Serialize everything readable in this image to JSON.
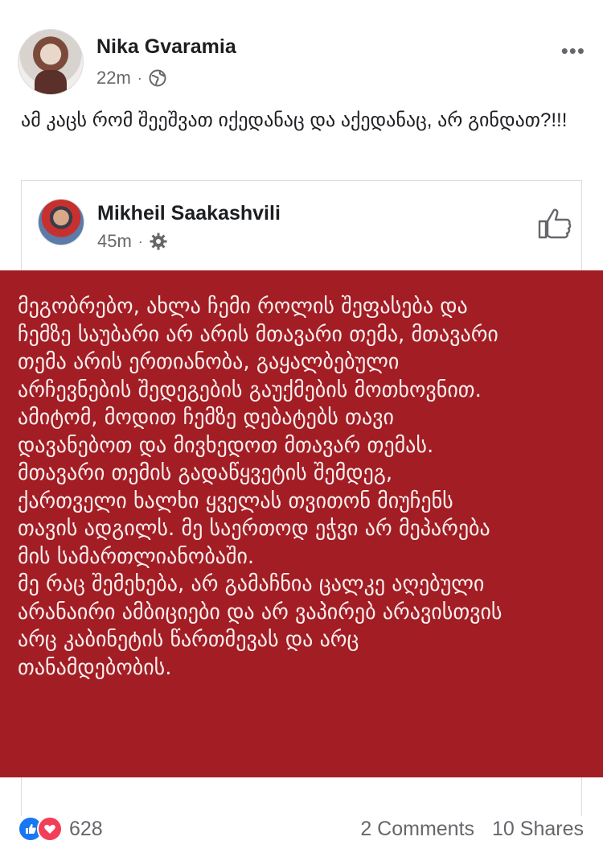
{
  "post": {
    "author": "Nika Gvaramia",
    "time": "22m",
    "separator": "·",
    "privacy_icon": "globe-icon",
    "more_label": "•••",
    "text": "ამ კაცს რომ შეეშვათ იქედანაც და აქედანაც, არ გინდათ?!!!"
  },
  "shared": {
    "author": "Mikheil Saakashvili",
    "time": "45m",
    "separator": "·",
    "privacy_icon": "gear-icon",
    "like_icon": "thumbs-up-icon",
    "text": "მეგობრებო, ახლა ჩემი როლის შეფასება და\nჩემზე საუბარი არ არის მთავარი თემა, მთავარი\nთემა არის ერთიანობა, გაყალბებული\nარჩევნების შედეგების გაუქმების მოთხოვნით.\nამიტომ, მოდით ჩემზე დებატებს თავი\nდავანებოთ და მივხედოთ მთავარ თემას.\nმთავარი თემის გადაწყვეტის შემდეგ,\nქართველი ხალხი ყველას თვითონ მიუჩენს\nთავის ადგილს. მე საერთოდ ეჭვი არ მეპარება\nმის სამართლიანობაში.\nმე რაც შემეხება, არ გამაჩნია ცალკე აღებული\nარანაირი ამბიციები და არ ვაპირებ არავისთვის\nარც კაბინეტის წართმევას და არც\nთანამდებობის.",
    "panel_color": "#a31d24"
  },
  "footer": {
    "reaction_count": "628",
    "comments": "2 Comments",
    "shares": "10 Shares",
    "like_color": "#1877f2",
    "love_color": "#f33e58"
  }
}
